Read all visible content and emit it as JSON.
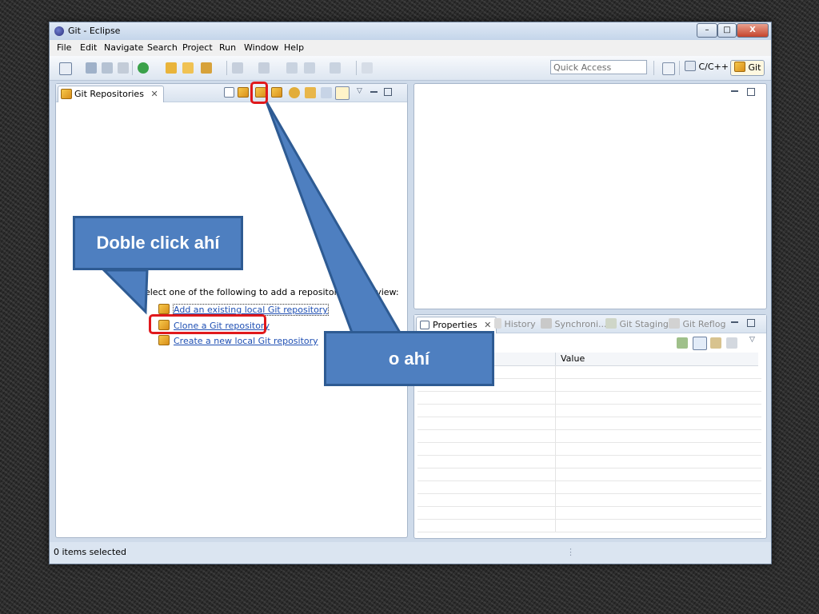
{
  "window": {
    "title": "Git - Eclipse",
    "controls": {
      "minimize": "–",
      "maximize": "□",
      "close": "X"
    }
  },
  "menu": [
    "File",
    "Edit",
    "Navigate",
    "Search",
    "Project",
    "Run",
    "Window",
    "Help"
  ],
  "toolbar": {
    "quick_access_placeholder": "Quick Access",
    "perspectives": [
      "C/C++",
      "Git"
    ]
  },
  "git_repositories": {
    "tab_label": "Git Repositories",
    "tab_close": "✕",
    "intro_text": "Select one of the following to add a repository to this view:",
    "links": [
      "Add an existing local Git repository",
      "Clone a Git repository",
      "Create a new local Git repository"
    ]
  },
  "bottom_panel": {
    "tabs": [
      {
        "label": "Properties",
        "active": true
      },
      {
        "label": "History",
        "active": false
      },
      {
        "label": "Synchroni...",
        "active": false
      },
      {
        "label": "Git Staging",
        "active": false
      },
      {
        "label": "Git Reflog",
        "active": false
      }
    ],
    "table_headers": [
      "",
      "Value"
    ]
  },
  "status": {
    "text": "0 items selected"
  },
  "callouts": {
    "left": "Doble click ahí",
    "right": "o ahí"
  },
  "colors": {
    "callout_fill": "#4e7fc0",
    "highlight": "#e0191c",
    "link": "#1f4fb3"
  }
}
